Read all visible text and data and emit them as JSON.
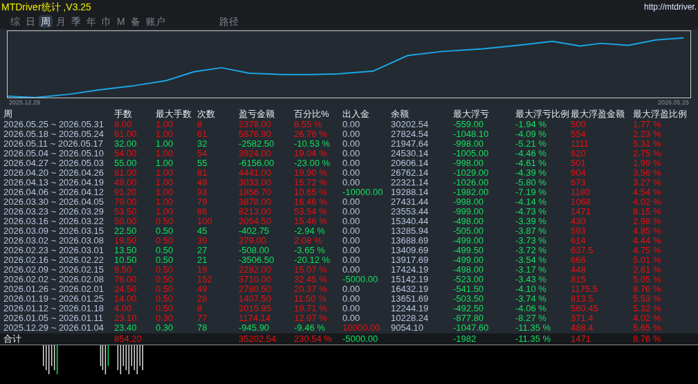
{
  "title": "MTDriver统计 ,V3.25",
  "link": "http://mtdriver.",
  "tabs": [
    {
      "label": "综",
      "selected": false
    },
    {
      "label": "日",
      "selected": false
    },
    {
      "label": "周",
      "selected": true
    },
    {
      "label": "月",
      "selected": false
    },
    {
      "label": "季",
      "selected": false
    },
    {
      "label": "年",
      "selected": false
    },
    {
      "label": "巾",
      "selected": false
    },
    {
      "label": "M",
      "selected": false
    },
    {
      "label": "备",
      "selected": false
    },
    {
      "label": "账户",
      "selected": false
    },
    {
      "label": "路径",
      "selected": false
    }
  ],
  "chart": {
    "start_label": "2025.12.29",
    "end_label": "2026.05.25"
  },
  "columns": [
    "周",
    "手数",
    "最大手数",
    "次数",
    "盈亏金额",
    "百分比%",
    "出入金",
    "余额",
    "最大浮亏",
    "最大浮亏比例",
    "最大浮盈金额",
    "最大浮盈比例"
  ],
  "rows": [
    {
      "period": "2026.05.25 ~ 2026.05.31",
      "kind": "profit",
      "lots": "8.00",
      "max_lots": "1.00",
      "count": "8",
      "pnl": "2378.00",
      "pct": "8.55 %",
      "flow": {
        "text": "0.00",
        "kind": "zero"
      },
      "balance": "30202.54",
      "max_dd": "-559.00",
      "max_dd_pct": "-1.94 %",
      "max_fp": "500",
      "max_fp_pct": "1.77 %"
    },
    {
      "period": "2026.05.18 ~ 2026.05.24",
      "kind": "profit",
      "lots": "61.00",
      "max_lots": "1.00",
      "count": "61",
      "pnl": "5876.90",
      "pct": "26.78 %",
      "flow": {
        "text": "0.00",
        "kind": "zero"
      },
      "balance": "27824.54",
      "max_dd": "-1048.10",
      "max_dd_pct": "-4.09 %",
      "max_fp": "554",
      "max_fp_pct": "2.23 %"
    },
    {
      "period": "2026.05.11 ~ 2026.05.17",
      "kind": "loss",
      "lots": "32.00",
      "max_lots": "1.00",
      "count": "32",
      "pnl": "-2582.50",
      "pct": "-10.53 %",
      "flow": {
        "text": "0.00",
        "kind": "zero"
      },
      "balance": "21947.64",
      "max_dd": "-998.00",
      "max_dd_pct": "-5.21 %",
      "max_fp": "1111",
      "max_fp_pct": "5.31 %"
    },
    {
      "period": "2026.05.04 ~ 2026.05.10",
      "kind": "profit",
      "lots": "54.00",
      "max_lots": "1.00",
      "count": "54",
      "pnl": "3924.00",
      "pct": "19.04 %",
      "flow": {
        "text": "0.00",
        "kind": "zero"
      },
      "balance": "24530.14",
      "max_dd": "-1005.00",
      "max_dd_pct": "-4.46 %",
      "max_fp": "620",
      "max_fp_pct": "2.75 %"
    },
    {
      "period": "2026.04.27 ~ 2026.05.03",
      "kind": "loss",
      "lots": "55.00",
      "max_lots": "1.00",
      "count": "55",
      "pnl": "-6156.00",
      "pct": "-23.00 %",
      "flow": {
        "text": "0.00",
        "kind": "zero"
      },
      "balance": "20606.14",
      "max_dd": "-998.00",
      "max_dd_pct": "-4.61 %",
      "max_fp": "501",
      "max_fp_pct": "1.99 %"
    },
    {
      "period": "2026.04.20 ~ 2026.04.26",
      "kind": "profit",
      "lots": "81.00",
      "max_lots": "1.00",
      "count": "81",
      "pnl": "4441.00",
      "pct": "19.90 %",
      "flow": {
        "text": "0.00",
        "kind": "zero"
      },
      "balance": "26762.14",
      "max_dd": "-1029.00",
      "max_dd_pct": "-4.39 %",
      "max_fp": "904",
      "max_fp_pct": "3.56 %"
    },
    {
      "period": "2026.04.13 ~ 2026.04.19",
      "kind": "profit",
      "lots": "49.00",
      "max_lots": "1.00",
      "count": "49",
      "pnl": "3033.00",
      "pct": "15.72 %",
      "flow": {
        "text": "0.00",
        "kind": "zero"
      },
      "balance": "22321.14",
      "max_dd": "-1026.00",
      "max_dd_pct": "-5.80 %",
      "max_fp": "673",
      "max_fp_pct": "3.27 %"
    },
    {
      "period": "2026.04.06 ~ 2026.04.12",
      "kind": "profit",
      "lots": "91.20",
      "max_lots": "1.00",
      "count": "93",
      "pnl": "1856.70",
      "pct": "10.65 %",
      "flow": {
        "text": "-10000.00",
        "kind": "withdraw"
      },
      "balance": "19288.14",
      "max_dd": "-1982.00",
      "max_dd_pct": "-7.19 %",
      "max_fp": "1180",
      "max_fp_pct": "4.54 %"
    },
    {
      "period": "2026.03.30 ~ 2026.04.05",
      "kind": "profit",
      "lots": "79.00",
      "max_lots": "1.00",
      "count": "79",
      "pnl": "3878.00",
      "pct": "16.46 %",
      "flow": {
        "text": "0.00",
        "kind": "zero"
      },
      "balance": "27431.44",
      "max_dd": "-998.00",
      "max_dd_pct": "-4.14 %",
      "max_fp": "1068",
      "max_fp_pct": "4.02 %"
    },
    {
      "period": "2026.03.23 ~ 2026.03.29",
      "kind": "profit",
      "lots": "53.50",
      "max_lots": "1.00",
      "count": "86",
      "pnl": "8213.00",
      "pct": "53.54 %",
      "flow": {
        "text": "0.00",
        "kind": "zero"
      },
      "balance": "23553.44",
      "max_dd": "-999.00",
      "max_dd_pct": "-4.73 %",
      "max_fp": "1471",
      "max_fp_pct": "8.15 %"
    },
    {
      "period": "2026.03.16 ~ 2026.03.22",
      "kind": "profit",
      "lots": "50.00",
      "max_lots": "0.50",
      "count": "100",
      "pnl": "2054.50",
      "pct": "15.46 %",
      "flow": {
        "text": "0.00",
        "kind": "zero"
      },
      "balance": "15340.44",
      "max_dd": "-498.00",
      "max_dd_pct": "-3.39 %",
      "max_fp": "430",
      "max_fp_pct": "2.98 %"
    },
    {
      "period": "2026.03.09 ~ 2026.03.15",
      "kind": "loss",
      "lots": "22.50",
      "max_lots": "0.50",
      "count": "45",
      "pnl": "-402.75",
      "pct": "-2.94 %",
      "flow": {
        "text": "0.00",
        "kind": "zero"
      },
      "balance": "13285.94",
      "max_dd": "-505.00",
      "max_dd_pct": "-3.87 %",
      "max_fp": "593",
      "max_fp_pct": "4.85 %"
    },
    {
      "period": "2026.03.02 ~ 2026.03.08",
      "kind": "profit",
      "lots": "19.50",
      "max_lots": "0.50",
      "count": "39",
      "pnl": "279.00",
      "pct": "2.08 %",
      "flow": {
        "text": "0.00",
        "kind": "zero"
      },
      "balance": "13688.69",
      "max_dd": "-499.00",
      "max_dd_pct": "-3.73 %",
      "max_fp": "614",
      "max_fp_pct": "4.44 %"
    },
    {
      "period": "2026.02.23 ~ 2026.03.01",
      "kind": "loss",
      "lots": "13.50",
      "max_lots": "0.50",
      "count": "27",
      "pnl": "-508.00",
      "pct": "-3.65 %",
      "flow": {
        "text": "0.00",
        "kind": "zero"
      },
      "balance": "13409.69",
      "max_dd": "-499.50",
      "max_dd_pct": "-3.72 %",
      "max_fp": "637.5",
      "max_fp_pct": "4.75 %"
    },
    {
      "period": "2026.02.16 ~ 2026.02.22",
      "kind": "loss",
      "lots": "10.50",
      "max_lots": "0.50",
      "count": "21",
      "pnl": "-3506.50",
      "pct": "-20.12 %",
      "flow": {
        "text": "0.00",
        "kind": "zero"
      },
      "balance": "13917.69",
      "max_dd": "-499.00",
      "max_dd_pct": "-3.54 %",
      "max_fp": "666",
      "max_fp_pct": "5.01 %"
    },
    {
      "period": "2026.02.09 ~ 2026.02.15",
      "kind": "profit",
      "lots": "9.50",
      "max_lots": "0.50",
      "count": "19",
      "pnl": "2282.00",
      "pct": "15.07 %",
      "flow": {
        "text": "0.00",
        "kind": "zero"
      },
      "balance": "17424.19",
      "max_dd": "-498.00",
      "max_dd_pct": "-3.17 %",
      "max_fp": "448",
      "max_fp_pct": "2.81 %"
    },
    {
      "period": "2026.02.02 ~ 2026.02.08",
      "kind": "profit",
      "lots": "76.00",
      "max_lots": "0.50",
      "count": "152",
      "pnl": "3710.00",
      "pct": "32.45 %",
      "flow": {
        "text": "-5000.00",
        "kind": "withdraw"
      },
      "balance": "15142.19",
      "max_dd": "-523.00",
      "max_dd_pct": "-3.43 %",
      "max_fp": "815",
      "max_fp_pct": "5.05 %"
    },
    {
      "period": "2026.01.26 ~ 2026.02.01",
      "kind": "profit",
      "lots": "24.50",
      "max_lots": "0.50",
      "count": "49",
      "pnl": "2780.50",
      "pct": "20.37 %",
      "flow": {
        "text": "0.00",
        "kind": "zero"
      },
      "balance": "16432.19",
      "max_dd": "-541.50",
      "max_dd_pct": "-4.10 %",
      "max_fp": "1175.5",
      "max_fp_pct": "8.76 %"
    },
    {
      "period": "2026.01.19 ~ 2026.01.25",
      "kind": "profit",
      "lots": "14.00",
      "max_lots": "0.50",
      "count": "28",
      "pnl": "1407.50",
      "pct": "11.50 %",
      "flow": {
        "text": "0.00",
        "kind": "zero"
      },
      "balance": "13651.69",
      "max_dd": "-503.50",
      "max_dd_pct": "-3.74 %",
      "max_fp": "813.5",
      "max_fp_pct": "5.53 %"
    },
    {
      "period": "2026.01.12 ~ 2026.01.18",
      "kind": "profit",
      "lots": "4.00",
      "max_lots": "0.50",
      "count": "8",
      "pnl": "2015.95",
      "pct": "19.71 %",
      "flow": {
        "text": "0.00",
        "kind": "zero"
      },
      "balance": "12244.19",
      "max_dd": "-492.50",
      "max_dd_pct": "-4.06 %",
      "max_fp": "560.45",
      "max_fp_pct": "5.32 %"
    },
    {
      "period": "2026.01.05 ~ 2026.01.11",
      "kind": "profit",
      "lots": "23.10",
      "max_lots": "0.30",
      "count": "77",
      "pnl": "1174.14",
      "pct": "12.97 %",
      "flow": {
        "text": "0.00",
        "kind": "zero"
      },
      "balance": "10228.24",
      "max_dd": "-877.80",
      "max_dd_pct": "-8.27 %",
      "max_fp": "371.4",
      "max_fp_pct": "4.02 %"
    },
    {
      "period": "2025.12.29 ~ 2026.01.04",
      "kind": "loss",
      "lots": "23.40",
      "max_lots": "0.30",
      "count": "78",
      "pnl": "-945.90",
      "pct": "-9.46 %",
      "flow": {
        "text": "10000.00",
        "kind": "deposit"
      },
      "balance": "9054.10",
      "max_dd": "-1047.60",
      "max_dd_pct": "-11.35 %",
      "max_fp": "488.4",
      "max_fp_pct": "5.65 %"
    }
  ],
  "total": {
    "label": "合计",
    "lots": "854.20",
    "pnl": "35202.54",
    "pct": "230.54 %",
    "flow": {
      "text": "-5000.00",
      "kind": "withdraw"
    },
    "max_dd": "-1982",
    "max_dd_pct": "-11.35 %",
    "max_fp": "1471",
    "max_fp_pct": "8.76 %"
  }
}
